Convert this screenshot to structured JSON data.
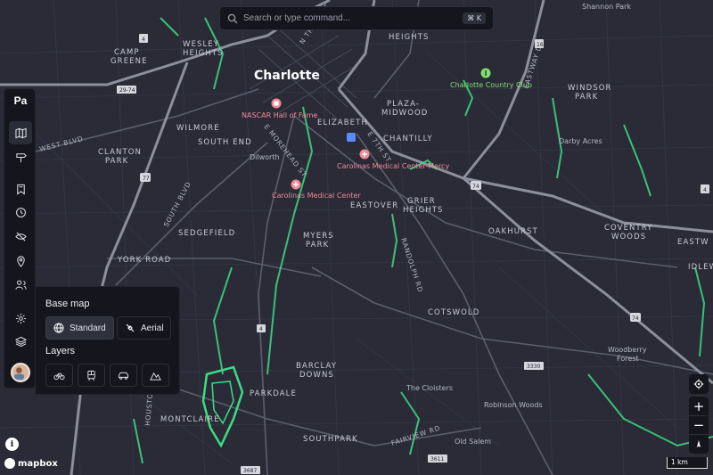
{
  "search": {
    "placeholder": "Search or type command...",
    "shortcut": "⌘ K"
  },
  "rail": {
    "brand": "Pa",
    "items": [
      {
        "name": "map",
        "icon": "map-icon",
        "active": true
      },
      {
        "name": "directions",
        "icon": "signpost-icon"
      },
      {
        "name": "saved",
        "icon": "bookmark-icon"
      },
      {
        "name": "history",
        "icon": "history-icon"
      },
      {
        "name": "hidden",
        "icon": "eye-off-icon"
      },
      {
        "name": "places",
        "icon": "location-pin-icon"
      },
      {
        "name": "people",
        "icon": "users-icon"
      },
      {
        "name": "settings",
        "icon": "gear-icon"
      },
      {
        "name": "layers",
        "icon": "layers-icon"
      }
    ]
  },
  "panel": {
    "base_map_title": "Base map",
    "base_map_options": [
      {
        "label": "Standard",
        "icon": "globe-icon",
        "selected": true
      },
      {
        "label": "Aerial",
        "icon": "satellite-icon",
        "selected": false
      }
    ],
    "layers_title": "Layers",
    "layers": [
      {
        "name": "bike",
        "icon": "bicycle-icon"
      },
      {
        "name": "transit",
        "icon": "train-icon"
      },
      {
        "name": "traffic",
        "icon": "car-icon"
      },
      {
        "name": "terrain",
        "icon": "mountain-icon"
      }
    ]
  },
  "map": {
    "city": "Charlotte",
    "neighborhoods": [
      "WESLEY",
      "HEIGHTS",
      "CAMP",
      "GREENE",
      "WILMORE",
      "SOUTH END",
      "CLANTON",
      "PARK",
      "SEDGEFIELD",
      "YORK ROAD",
      "MYERS",
      "PARK",
      "EASTOVER",
      "GRIER",
      "HEIGHTS",
      "ELIZABETH",
      "CHANTILLY",
      "PLAZA-",
      "MIDWOOD",
      "HEIGHTS",
      "OAKHURST",
      "COVENTRY",
      "WOODS",
      "COTSWOLD",
      "BARCLAY",
      "DOWNS",
      "PARKDALE",
      "MONTCLAIRE",
      "SOUTHPARK",
      "WINDSOR",
      "PARK",
      "EASTW",
      "IDLEW"
    ],
    "places": [
      "Dilworth",
      "Darby Acres",
      "The Cloisters",
      "Robinson Woods",
      "Old Salem",
      "Woodberry",
      "Forest",
      "Shannon Park"
    ],
    "pois": [
      {
        "name": "NASCAR Hall of Fame",
        "color": "#f08b94"
      },
      {
        "name": "Carolinas Medical Center-Mercy",
        "color": "#f08b94"
      },
      {
        "name": "Carolinas Medical Center",
        "color": "#f08b94"
      },
      {
        "name": "Charlotte Country Club",
        "color": "#7fe06d"
      }
    ],
    "streets": [
      "W TRADE ST",
      "N TRYON ST",
      "E MOREHEAD ST",
      "E 7TH ST",
      "SOUTH BLVD",
      "RANDOLPH RD",
      "FAIRVIEW RD",
      "EASTWAY DR",
      "WEST BLVD",
      "HOUSTON"
    ],
    "shields": [
      "29-74",
      "77",
      "74",
      "4",
      "3330",
      "3687",
      "3611",
      "16",
      "4"
    ],
    "colors": {
      "background": "#2a2b37",
      "road": "#5a5c6b",
      "highway": "#8d8f9c",
      "park": "#3ddc84",
      "poi_medical": "#f08b94"
    }
  },
  "controls": {
    "locate_icon": "locate-icon",
    "zoom_in": "+",
    "zoom_out": "−",
    "compass_icon": "compass-icon",
    "scale": "1 km"
  },
  "attribution": {
    "info": "i",
    "brand": "mapbox"
  }
}
